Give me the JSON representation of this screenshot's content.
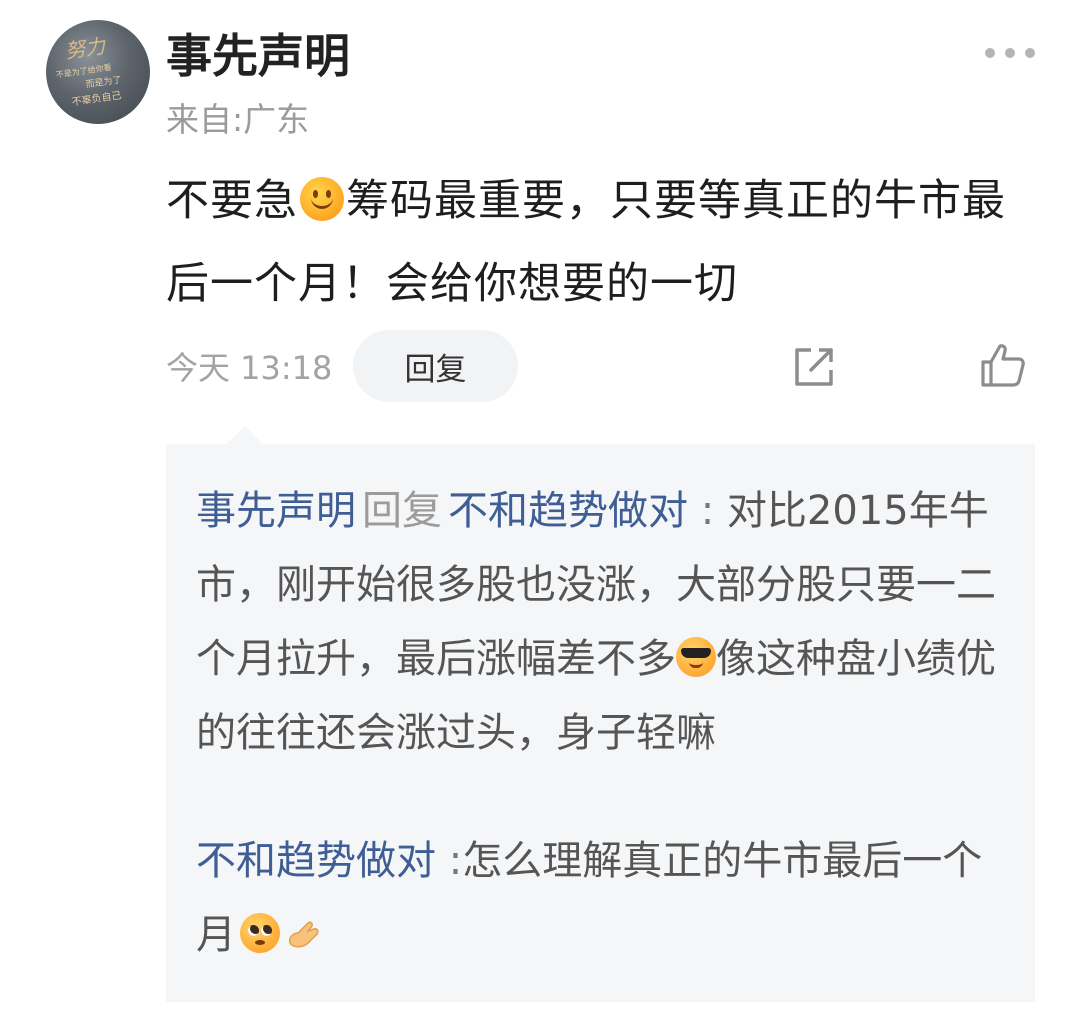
{
  "comment": {
    "username": "事先声明",
    "location": "来自:广东",
    "text_part1": "不要急",
    "emoji1": "smile-emoji",
    "text_part2": "筹码最重要，只要等真正的牛市最后一个月！会给你想要的一切",
    "timestamp": "今天 13:18",
    "reply_label": "回复",
    "avatar_text": [
      "努力",
      "不是为了给你看",
      "而是为了",
      "不辜负自己"
    ]
  },
  "replies": [
    {
      "author": "事先声明",
      "reply_word": "回复",
      "target": "不和趋势做对",
      "separator": ":",
      "text_part1": "对比2015年牛市，刚开始很多股也没涨，大部分股只要一二个月拉升，最后涨幅差不多",
      "emoji": "cool-emoji",
      "text_part2": "像这种盘小绩优的往往还会涨过头，身子轻嘛"
    },
    {
      "author": "不和趋势做对",
      "separator": ":",
      "text": "怎么理解真正的牛市最后一个月",
      "emojis": [
        "pleading-emoji",
        "pinching-hand-emoji"
      ]
    }
  ],
  "colors": {
    "name_link": "#3f5e95",
    "reply_bg": "#f5f6f8",
    "muted": "#9b9b9b"
  }
}
